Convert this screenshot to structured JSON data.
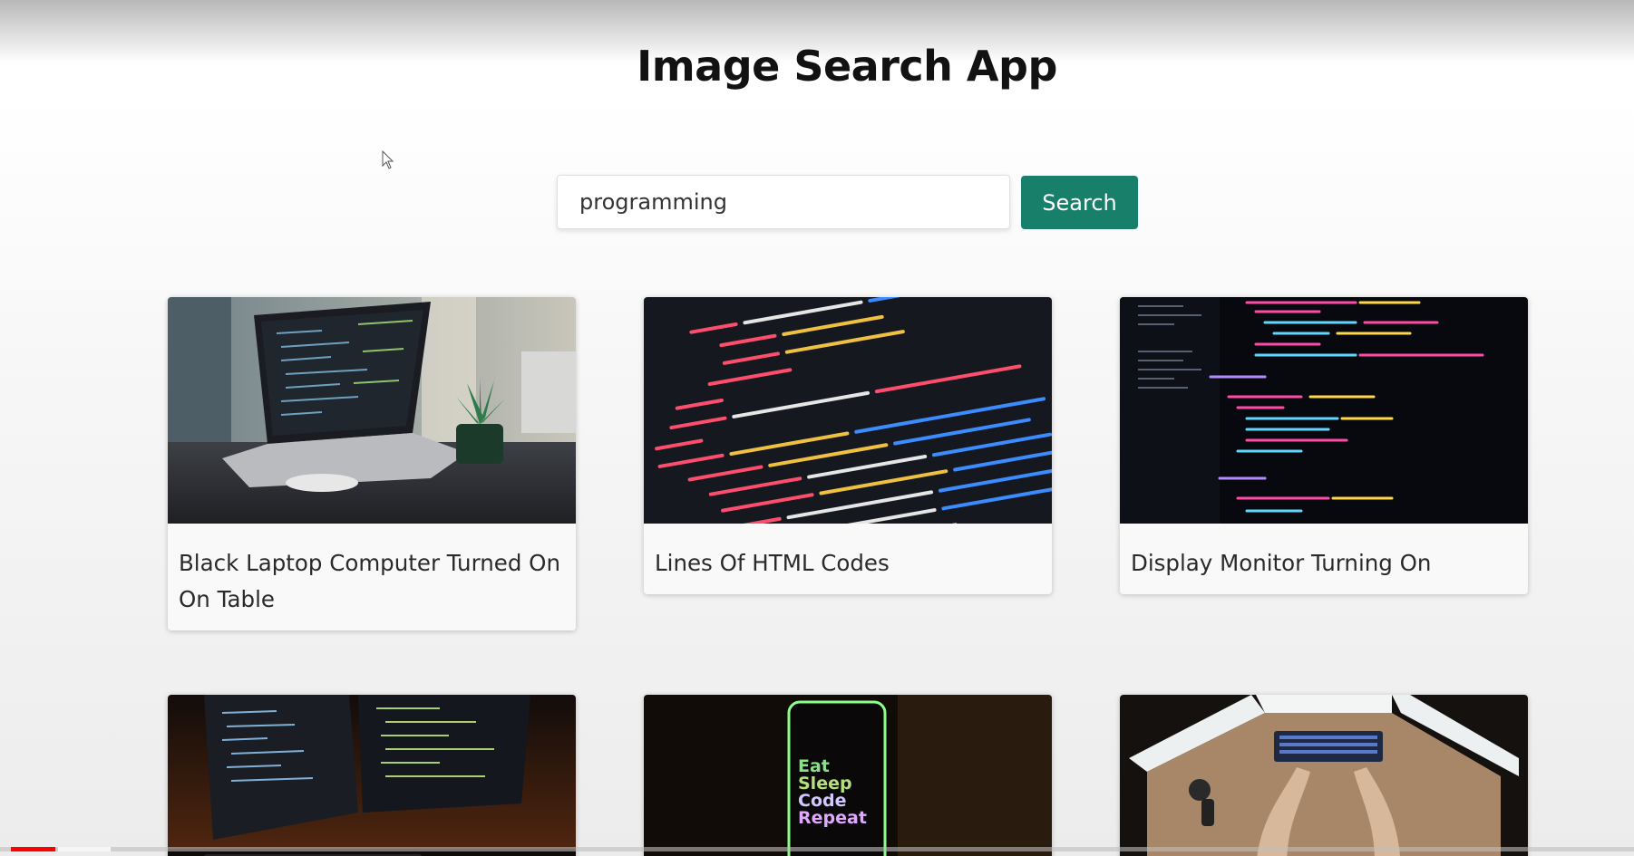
{
  "app": {
    "title": "Image Search App"
  },
  "search": {
    "value": "programming",
    "button_label": "Search"
  },
  "results": [
    {
      "caption": "Black Laptop Computer Turned On On Table"
    },
    {
      "caption": "Lines Of HTML Codes"
    },
    {
      "caption": "Display Monitor Turning On"
    },
    {
      "caption": ""
    },
    {
      "caption": "",
      "image_text": [
        "Eat",
        "Sleep",
        "Code",
        "Repeat"
      ]
    },
    {
      "caption": ""
    }
  ],
  "colors": {
    "accent": "#18806a",
    "progress": "#ff0000"
  },
  "icons": {
    "cursor": "pointer-cursor-icon"
  },
  "video": {
    "progress_fraction": 0.03
  }
}
